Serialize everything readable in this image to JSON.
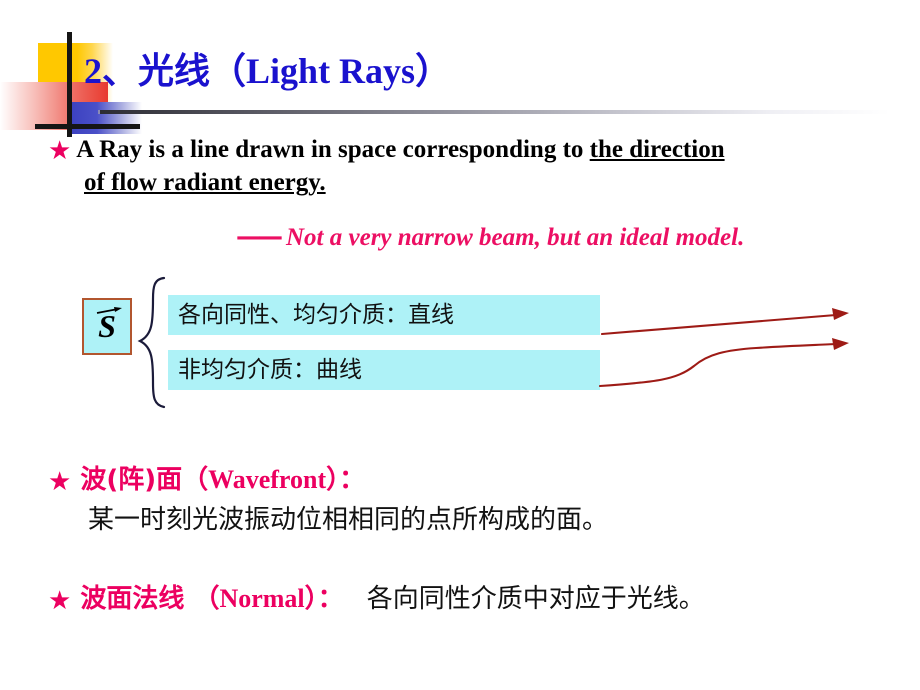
{
  "slide": {
    "title_number": "2、",
    "title_cn": "光线",
    "title_en": "（Light Rays）"
  },
  "ray_definition": {
    "bullet": "★",
    "line1_plain": "A Ray is a line drawn in space corresponding  to ",
    "line1_underlined": "the direction",
    "line2_underlined": "of flow radiant energy."
  },
  "note": {
    "dash": "——",
    "text": "Not a very narrow beam, but an ideal model."
  },
  "diagram": {
    "vector_symbol": "S",
    "vector_label": "S-vector",
    "box1_text": "各向同性、均匀介质：直线",
    "box2_text": "非均匀介质：曲线",
    "arrow1_label": "straight-ray-arrow",
    "arrow2_label": "curved-ray-arrow",
    "box_fill": "#AEF2F7",
    "box_border": "#B2562F",
    "arrow_color": "#9E1B16"
  },
  "wavefront": {
    "bullet": "★",
    "head_cn": "波(阵)面",
    "head_en": "（Wavefront）",
    "head_colon": "：",
    "body": "某一时刻光波振动位相相同的点所构成的面。"
  },
  "normal": {
    "bullet": "★",
    "head_cn": "波面法线 ",
    "head_en": "（Normal）",
    "head_colon": "：",
    "body": "各向同性介质中对应于光线。"
  },
  "colors": {
    "title_blue": "#1A12CE",
    "accent_pink": "#EC0060",
    "note_pink": "#EC0F63",
    "cyan": "#AEF2F7",
    "dark_red": "#9E1B16"
  }
}
